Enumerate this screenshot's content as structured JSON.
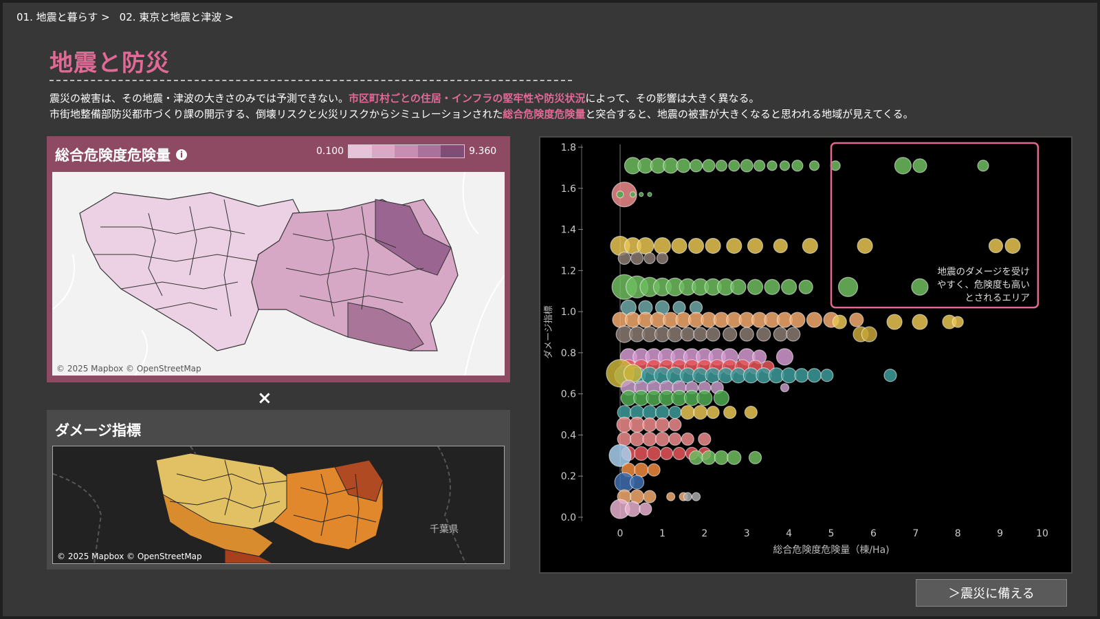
{
  "breadcrumbs": [
    "01. 地震と暮らす >",
    "02. 東京と地震と津波 >"
  ],
  "title": "地震と防災",
  "lead": {
    "line1_a": "震災の被害は、その地震・津波の大きさのみでは予測できない。",
    "line1_hl": "市区町村ごとの住居・インフラの堅牢性や防災状況",
    "line1_b": "によって、その影響は大きく異なる。",
    "line2_a": "市街地整備部防災都市づくり課の開示する、倒壊リスクと火災リスクからシミュレーションされた",
    "line2_hl": "総合危険度危険量",
    "line2_b": "と突合すると、地震の被害が大きくなると思われる地域が見えてくる。"
  },
  "panel_risk": {
    "title": "総合危険度危険量",
    "info_icon": "info-icon",
    "legend_min": "0.100",
    "legend_max": "9.360",
    "ramp_colors": [
      "#e7c3da",
      "#d9a9c6",
      "#c88db3",
      "#a8729b",
      "#7f4d75"
    ],
    "attribution": "© 2025 Mapbox  © OpenStreetMap"
  },
  "times_symbol": "×",
  "panel_damage": {
    "title": "ダメージ指標",
    "place_label": "千葉県",
    "attribution": "© 2025 Mapbox  © OpenStreetMap"
  },
  "chart_data": {
    "type": "scatter",
    "xlabel": "総合危険度危険量（棟/Ha)",
    "ylabel": "ダメージ指標",
    "xlim": [
      0,
      10
    ],
    "ylim": [
      0,
      1.8
    ],
    "xticks": [
      "0",
      "1",
      "2",
      "3",
      "4",
      "5",
      "6",
      "7",
      "8",
      "9",
      "10"
    ],
    "yticks": [
      "0.0",
      "0.2",
      "0.4",
      "0.6",
      "0.8",
      "1.0",
      "1.2",
      "1.4",
      "1.6",
      "1.8"
    ],
    "annotation": "地震のダメージを受け\nやすく、危険度も高い\nとされるエリア",
    "highlight_box": {
      "x": [
        5,
        9.9
      ],
      "y": [
        1.0,
        1.8
      ]
    },
    "rows": [
      {
        "y": 1.71,
        "color": "#6dbd5f",
        "x": [
          0.3,
          0.6,
          0.9,
          1.2,
          1.5,
          1.8,
          2.1,
          2.4,
          2.7,
          3.0,
          3.3,
          3.6,
          3.9,
          4.2,
          4.6,
          5.1,
          6.7,
          7.1,
          8.6
        ],
        "r": [
          12,
          11,
          11,
          11,
          10,
          9,
          9,
          8,
          8,
          9,
          8,
          7,
          7,
          8,
          7,
          7,
          12,
          10,
          8
        ]
      },
      {
        "y": 1.57,
        "color": "#ef8b8b",
        "x": [
          0.1
        ],
        "r": [
          18
        ]
      },
      {
        "y": 1.57,
        "color": "#4daa50",
        "x": [
          0.0,
          0.3,
          0.5,
          0.7
        ],
        "r": [
          5,
          4,
          3,
          3
        ]
      },
      {
        "y": 1.32,
        "color": "#e8c452",
        "x": [
          0.0,
          0.3,
          0.6,
          1.0,
          1.4,
          1.8,
          2.2,
          2.7,
          3.2,
          3.8,
          4.5,
          5.8,
          8.9,
          9.3
        ],
        "r": [
          14,
          12,
          12,
          12,
          11,
          11,
          11,
          11,
          11,
          10,
          11,
          11,
          10,
          11
        ]
      },
      {
        "y": 1.26,
        "color": "#8a7a72",
        "x": [
          0.1,
          0.4,
          0.7,
          1.0
        ],
        "r": [
          9,
          9,
          8,
          8
        ]
      },
      {
        "y": 1.12,
        "color": "#6dbd5f",
        "x": [
          0.1,
          0.4,
          0.7,
          1.0,
          1.3,
          1.6,
          1.9,
          2.2,
          2.5,
          2.8,
          3.2,
          3.6,
          4.0,
          4.4,
          5.4,
          7.1
        ],
        "r": [
          18,
          16,
          14,
          13,
          13,
          12,
          12,
          12,
          12,
          11,
          11,
          11,
          11,
          10,
          14,
          12
        ]
      },
      {
        "y": 1.02,
        "color": "#6fa8a8",
        "x": [
          0.2,
          0.6,
          1.0,
          1.4,
          1.8
        ],
        "r": [
          11,
          10,
          10,
          9,
          9
        ]
      },
      {
        "y": 0.96,
        "color": "#f2a96d",
        "x": [
          0.0,
          0.3,
          0.6,
          0.9,
          1.2,
          1.5,
          1.8,
          2.1,
          2.4,
          2.7,
          3.0,
          3.3,
          3.6,
          3.9,
          4.2,
          4.6,
          5.0,
          5.6
        ],
        "r": [
          11,
          11,
          11,
          11,
          11,
          11,
          11,
          11,
          11,
          11,
          11,
          11,
          11,
          11,
          11,
          11,
          11,
          10
        ]
      },
      {
        "y": 0.95,
        "color": "#e8c452",
        "x": [
          5.2,
          6.5,
          7.1,
          7.8,
          8.0
        ],
        "r": [
          10,
          11,
          11,
          10,
          8
        ]
      },
      {
        "y": 0.89,
        "color": "#8a7a72",
        "x": [
          0.1,
          0.4,
          0.7,
          1.0,
          1.3,
          1.6,
          1.9,
          2.2,
          2.6,
          3.0,
          3.4,
          3.8,
          4.1
        ],
        "r": [
          12,
          11,
          11,
          11,
          11,
          10,
          10,
          10,
          10,
          10,
          10,
          10,
          10
        ]
      },
      {
        "y": 0.89,
        "color": "#c9a63a",
        "x": [
          5.7,
          5.9
        ],
        "r": [
          11,
          11
        ]
      },
      {
        "y": 0.78,
        "color": "#d59ad1",
        "x": [
          0.2,
          0.5,
          0.8,
          1.1,
          1.4,
          1.7,
          2.0,
          2.3,
          2.6,
          3.0,
          3.3,
          3.9
        ],
        "r": [
          12,
          12,
          12,
          12,
          12,
          12,
          12,
          12,
          12,
          12,
          10,
          12
        ]
      },
      {
        "y": 0.73,
        "color": "#e8555a",
        "x": [
          0.2,
          0.5,
          0.8,
          1.1,
          1.4,
          1.7,
          2.0,
          2.3,
          2.6,
          2.9,
          3.2,
          3.5
        ],
        "r": [
          11,
          11,
          11,
          11,
          11,
          11,
          11,
          11,
          11,
          11,
          10,
          9
        ]
      },
      {
        "y": 0.69,
        "color": "#3e9b9b",
        "x": [
          0.1,
          0.4,
          0.7,
          1.0,
          1.3,
          1.6,
          1.9,
          2.2,
          2.5,
          2.8,
          3.1,
          3.4,
          3.7,
          4.0,
          4.3,
          4.6,
          4.9,
          6.4
        ],
        "r": [
          14,
          12,
          12,
          12,
          12,
          11,
          11,
          11,
          11,
          11,
          11,
          11,
          11,
          11,
          10,
          10,
          9,
          9
        ]
      },
      {
        "y": 0.7,
        "color": "#c9b33a",
        "x": [
          0.0,
          0.3
        ],
        "r": [
          20,
          13
        ]
      },
      {
        "y": 0.63,
        "color": "#c49ac8",
        "x": [
          0.2,
          0.5,
          0.8,
          1.1,
          1.4,
          1.7,
          2.0,
          2.3,
          3.9
        ],
        "r": [
          11,
          10,
          10,
          10,
          10,
          9,
          9,
          9,
          6
        ]
      },
      {
        "y": 0.58,
        "color": "#4daa50",
        "x": [
          0.2,
          0.5,
          0.8,
          1.1,
          1.4,
          1.7,
          2.0,
          2.4
        ],
        "r": [
          11,
          11,
          11,
          11,
          11,
          11,
          11,
          11
        ]
      },
      {
        "y": 0.51,
        "color": "#3e9b9b",
        "x": [
          0.1,
          0.4,
          0.7,
          1.0,
          1.3
        ],
        "r": [
          10,
          10,
          10,
          10,
          9
        ]
      },
      {
        "y": 0.51,
        "color": "#e8c452",
        "x": [
          1.6,
          1.9,
          2.2,
          2.6,
          3.1
        ],
        "r": [
          10,
          10,
          9,
          9,
          9
        ]
      },
      {
        "y": 0.45,
        "color": "#ef8b8b",
        "x": [
          0.1,
          0.4,
          0.7,
          1.0,
          1.3
        ],
        "r": [
          11,
          11,
          10,
          10,
          9
        ]
      },
      {
        "y": 0.38,
        "color": "#ef8b8b",
        "x": [
          0.1,
          0.4,
          0.7,
          1.0,
          1.3,
          1.6,
          2.0
        ],
        "r": [
          10,
          10,
          10,
          10,
          9,
          9,
          9
        ]
      },
      {
        "y": 0.31,
        "color": "#e8555a",
        "x": [
          0.2,
          0.5,
          0.8,
          1.1,
          1.4,
          1.7,
          2.0
        ],
        "r": [
          10,
          10,
          10,
          9,
          9,
          9,
          9
        ]
      },
      {
        "y": 0.29,
        "color": "#6dbd5f",
        "x": [
          1.8,
          2.1,
          2.4,
          2.7,
          3.2
        ],
        "r": [
          10,
          10,
          10,
          10,
          9
        ]
      },
      {
        "y": 0.3,
        "color": "#a8d0f0",
        "x": [
          0.0
        ],
        "r": [
          16
        ]
      },
      {
        "y": 0.23,
        "color": "#f08a3e",
        "x": [
          0.2,
          0.5,
          0.8
        ],
        "r": [
          10,
          10,
          9
        ]
      },
      {
        "y": 0.17,
        "color": "#3f6fb0",
        "x": [
          0.1,
          0.4
        ],
        "r": [
          14,
          10
        ]
      },
      {
        "y": 0.1,
        "color": "#f2a96d",
        "x": [
          0.1,
          0.4,
          0.7,
          1.2,
          1.5
        ],
        "r": [
          10,
          10,
          9,
          6,
          6
        ]
      },
      {
        "y": 0.1,
        "color": "#aaaaaa",
        "x": [
          1.6,
          1.8
        ],
        "r": [
          6,
          6
        ]
      },
      {
        "y": 0.04,
        "color": "#e7b0cf",
        "x": [
          0.0,
          0.3,
          0.6
        ],
        "r": [
          14,
          11,
          9
        ]
      }
    ]
  },
  "cta_label": "＞震災に備える"
}
